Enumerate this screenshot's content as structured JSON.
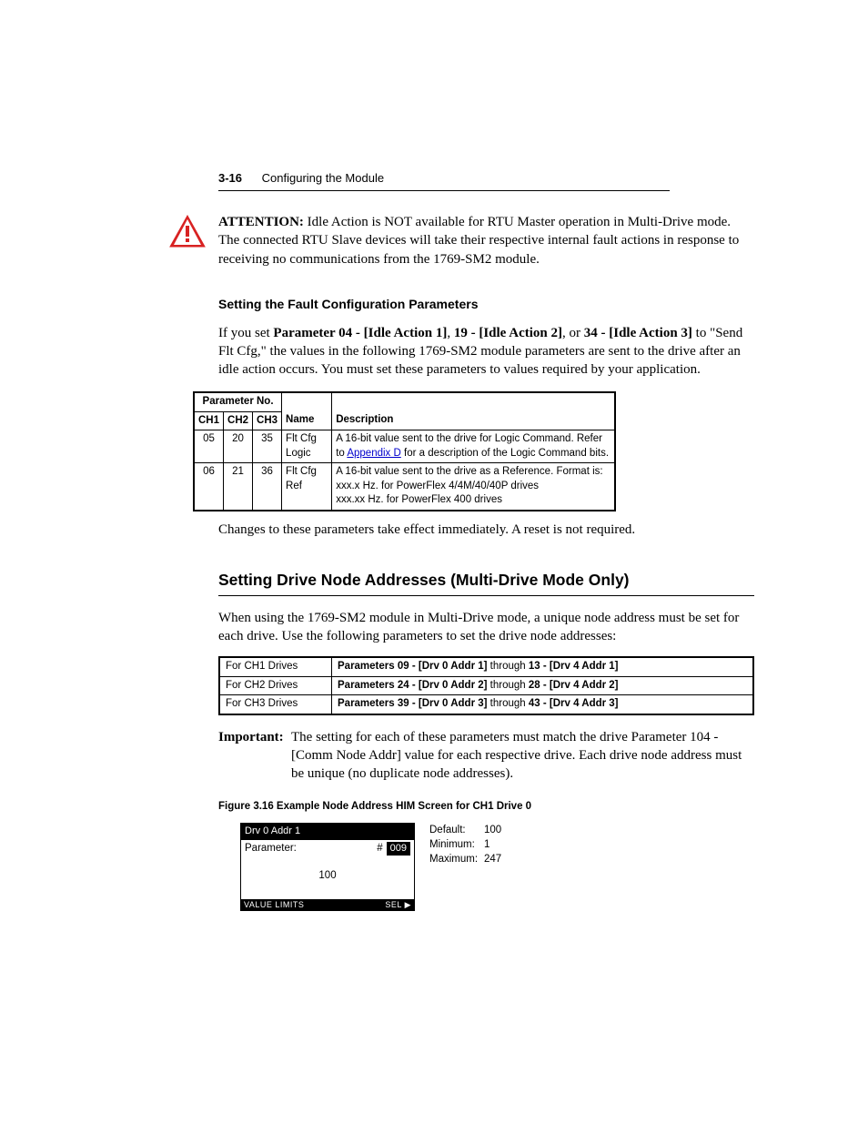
{
  "header": {
    "page_number": "3-16",
    "chapter_title": "Configuring the Module"
  },
  "attention": {
    "label": "ATTENTION:",
    "text": "Idle Action is NOT available for RTU Master operation in Multi-Drive mode. The connected RTU Slave devices will take their respective internal fault actions in response to receiving no communications from the 1769-SM2 module."
  },
  "section_fault_cfg": {
    "heading": "Setting the Fault Configuration Parameters",
    "para_pre": "If you set ",
    "b1": "Parameter 04 - [Idle Action 1]",
    "sep1": ", ",
    "b2": "19 - [Idle Action 2]",
    "sep2": ", or ",
    "b3": "34 - [Idle Action 3]",
    "para_post": " to \"Send Flt Cfg,\" the values in the following 1769-SM2 module parameters are sent to the drive after an idle action occurs. You must set these parameters to values required by your application."
  },
  "param_table": {
    "group_header": "Parameter No.",
    "cols": {
      "ch1": "CH1",
      "ch2": "CH2",
      "ch3": "CH3",
      "name": "Name",
      "desc": "Description"
    },
    "rows": [
      {
        "ch1": "05",
        "ch2": "20",
        "ch3": "35",
        "name": "Flt Cfg Logic",
        "desc_pre": "A 16-bit value sent to the drive for Logic Command. Refer to ",
        "desc_link": "Appendix D",
        "desc_post": " for a description of the Logic Command bits."
      },
      {
        "ch1": "06",
        "ch2": "21",
        "ch3": "36",
        "name": "Flt Cfg Ref",
        "desc_pre": "A 16-bit value sent to the drive as a Reference. Format is:\nxxx.x Hz. for PowerFlex 4/4M/40/40P drives\nxxx.xx Hz. for PowerFlex 400 drives",
        "desc_link": "",
        "desc_post": ""
      }
    ],
    "footnote": "Changes to these parameters take effect immediately. A reset is not required."
  },
  "section_node": {
    "heading": "Setting Drive Node Addresses (Multi-Drive Mode Only)",
    "intro": "When using the 1769-SM2 module in Multi-Drive mode, a unique node address must be set for each drive. Use the following parameters to set the drive node addresses:"
  },
  "drive_table": {
    "rows": [
      {
        "label": "For CH1 Drives",
        "b1": "Parameters 09 - [Drv 0 Addr 1]",
        "mid": " through ",
        "b2": "13 - [Drv 4 Addr 1]"
      },
      {
        "label": "For CH2 Drives",
        "b1": "Parameters 24 - [Drv 0 Addr 2]",
        "mid": " through ",
        "b2": "28 - [Drv 4 Addr 2]"
      },
      {
        "label": "For CH3 Drives",
        "b1": "Parameters 39 - [Drv 0 Addr 3]",
        "mid": " through ",
        "b2": "43 - [Drv 4 Addr 3]"
      }
    ]
  },
  "important": {
    "label": "Important:",
    "text": "The setting for each of these parameters must match the drive Parameter 104 - [Comm Node Addr] value for each respective drive. Each drive node address must be unique (no duplicate node addresses)."
  },
  "figure": {
    "caption": "Figure 3.16   Example Node Address HIM Screen for CH1 Drive 0",
    "him": {
      "title": "Drv 0 Addr 1",
      "param_label": "Parameter:",
      "hash": "#",
      "param_no": "009",
      "value": "100",
      "footer_left": "VALUE   LIMITS",
      "footer_right": "SEL ▶"
    },
    "side": [
      {
        "k": "Default:",
        "v": "100"
      },
      {
        "k": "Minimum:",
        "v": "1"
      },
      {
        "k": "Maximum:",
        "v": "247"
      }
    ]
  }
}
